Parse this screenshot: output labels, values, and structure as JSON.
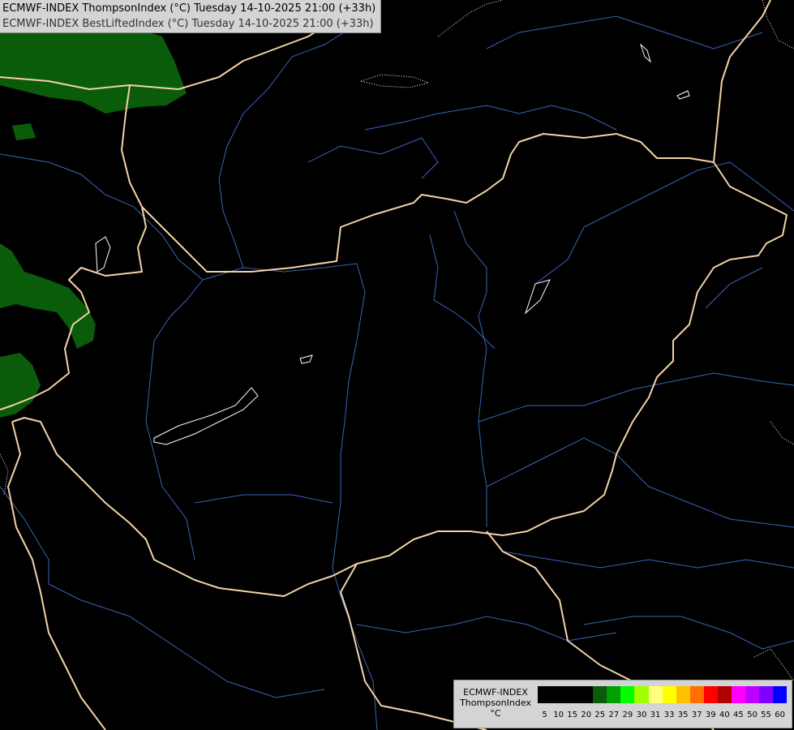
{
  "title": {
    "line1": "ECMWF-INDEX ThompsonIndex (°C) Tuesday 14-10-2025 21:00 (+33h)",
    "line2": "ECMWF-INDEX BestLiftedIndex (°C) Tuesday 14-10-2025 21:00 (+33h)"
  },
  "map": {
    "background_color": "#000000",
    "border_color": "#f2d2a6",
    "river_color": "#3a64b8",
    "lake_color": "#ffffff",
    "field_color": "#0a5c0a"
  },
  "legend": {
    "line1": "ECMWF-INDEX",
    "line2": "ThompsonIndex",
    "line3": "°C",
    "colors": [
      "#000000",
      "#000000",
      "#000000",
      "#000000",
      "#0a5c0a",
      "#00a000",
      "#00ff00",
      "#a0ff00",
      "#ffff80",
      "#ffff00",
      "#ffc000",
      "#ff7000",
      "#ff0000",
      "#b00000",
      "#ff00ff",
      "#c000ff",
      "#8000ff",
      "#0000ff"
    ],
    "ticks": [
      "5",
      "10",
      "15",
      "20",
      "25",
      "27",
      "29",
      "30",
      "31",
      "33",
      "35",
      "37",
      "39",
      "40",
      "45",
      "50",
      "55",
      "60"
    ]
  }
}
